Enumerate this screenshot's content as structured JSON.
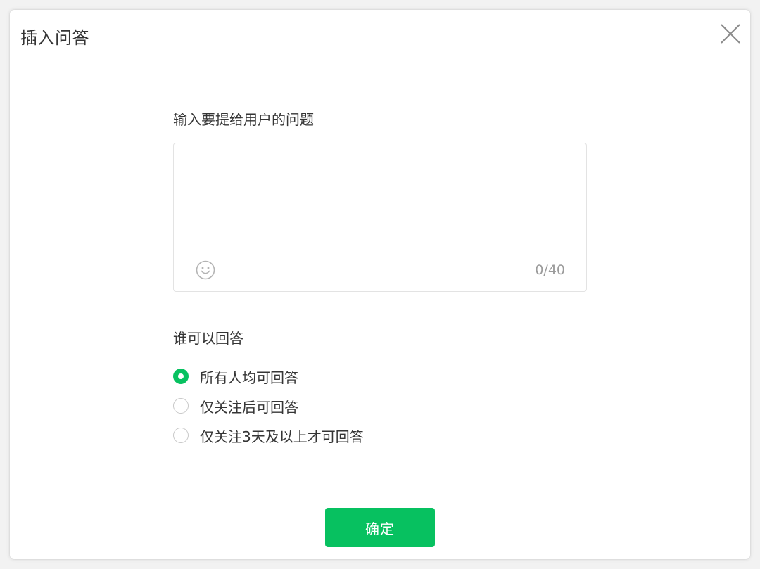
{
  "dialog": {
    "title": "插入问答",
    "close_icon": "close-icon"
  },
  "question": {
    "label": "输入要提给用户的问题",
    "value": "",
    "placeholder": "",
    "counter": "0/40",
    "emoji_icon": "smiley-icon"
  },
  "who_can_answer": {
    "label": "谁可以回答",
    "options": [
      {
        "label": "所有人均可回答",
        "checked": true
      },
      {
        "label": "仅关注后可回答",
        "checked": false
      },
      {
        "label": "仅关注3天及以上才可回答",
        "checked": false
      }
    ]
  },
  "confirm": {
    "label": "确定"
  },
  "colors": {
    "accent": "#07c160",
    "text": "#353535",
    "muted": "#9b9b9b",
    "border": "#e3e3e3"
  }
}
